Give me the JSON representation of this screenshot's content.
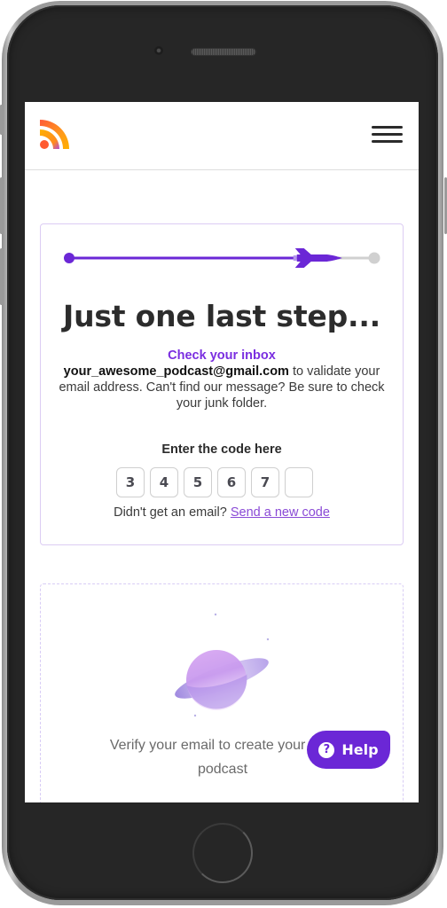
{
  "device": {
    "type": "phone",
    "frame_color": "#262626"
  },
  "navbar": {
    "logo_icon": "rss-feed-icon",
    "menu_icon": "hamburger-menu-icon"
  },
  "progress": {
    "fraction_complete": 0.88,
    "icon": "rocket-icon",
    "active_color": "#6b27d6",
    "inactive_color": "#d0d0d0"
  },
  "verification": {
    "title": "Just one last step...",
    "inbox_heading": "Check your inbox",
    "email": "your_awesome_podcast@gmail.com",
    "message": " to validate your email address. Can't find our message? Be sure to check your junk folder.",
    "code_label": "Enter the code here",
    "code_digits": [
      "3",
      "4",
      "5",
      "6",
      "7",
      ""
    ],
    "resend_prompt": "Didn't get an email? ",
    "resend_link": "Send a new code"
  },
  "placeholder": {
    "illustration": "planet-icon",
    "text": "Verify your email to create your new podcast"
  },
  "help_button": {
    "icon": "question-circle-icon",
    "icon_glyph": "?",
    "label": "Help"
  },
  "colors": {
    "accent": "#6b27d6",
    "accent_text": "#7a2ee0",
    "link": "#8a4ad6",
    "card_border": "#dcccf3"
  }
}
